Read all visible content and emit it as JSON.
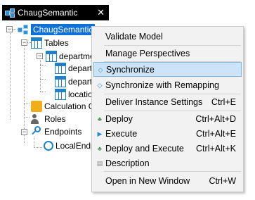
{
  "tab": {
    "title": "ChaugSemantic",
    "close_glyph": "✕"
  },
  "tree": {
    "root": "ChaugSemantic",
    "tables": "Tables",
    "department_table": "departmen",
    "col1": "departi",
    "col2": "departi",
    "col3": "locatio",
    "calc_groups": "Calculation Gr",
    "roles": "Roles",
    "endpoints": "Endpoints",
    "local_endpoint": "LocalEndp"
  },
  "menu": {
    "items": [
      {
        "label": "Validate Model",
        "shortcut": "",
        "icon": ""
      },
      {
        "label": "Manage Perspectives",
        "shortcut": "",
        "icon": ""
      },
      {
        "label": "Synchronize",
        "shortcut": "",
        "icon": "sync-icon"
      },
      {
        "label": "Synchronize with Remapping",
        "shortcut": "",
        "icon": "sync-remap-icon"
      },
      {
        "label": "Deliver Instance Settings",
        "shortcut": "Ctrl+E",
        "icon": ""
      },
      {
        "label": "Deploy",
        "shortcut": "Ctrl+Alt+D",
        "icon": "deploy-icon"
      },
      {
        "label": "Execute",
        "shortcut": "Ctrl+Alt+E",
        "icon": "execute-icon"
      },
      {
        "label": "Deploy and Execute",
        "shortcut": "Ctrl+Alt+K",
        "icon": "deploy-execute-icon"
      },
      {
        "label": "Description",
        "shortcut": "",
        "icon": "description-icon"
      },
      {
        "label": "Open in New Window",
        "shortcut": "Ctrl+W",
        "icon": ""
      }
    ],
    "highlighted": "Synchronize"
  },
  "colors": {
    "selection": "#0f70d6",
    "menu_highlight": "#cce4f7",
    "tab_bg": "#000000"
  }
}
